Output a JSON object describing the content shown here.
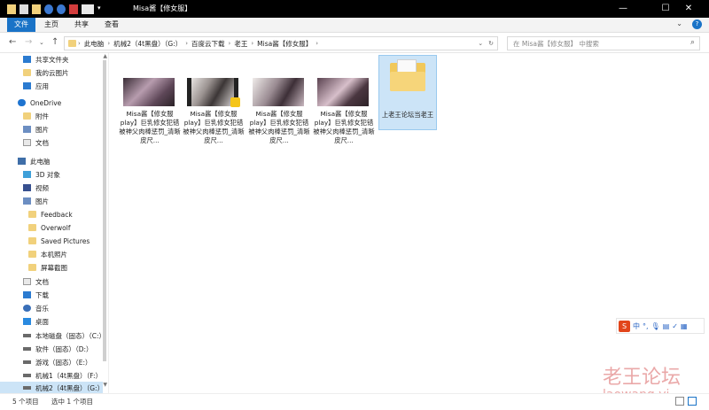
{
  "window": {
    "title": "Misa酱【修女服】",
    "controls": {
      "minimize": "—",
      "maximize": "☐",
      "close": "✕"
    }
  },
  "ribbon": {
    "tabs": [
      {
        "label": "文件",
        "active": true
      },
      {
        "label": "主页",
        "active": false
      },
      {
        "label": "共享",
        "active": false
      },
      {
        "label": "查看",
        "active": false
      }
    ],
    "help": "?"
  },
  "address": {
    "crumbs": [
      "此电脑",
      "机械2（4t黑盘）（G:）",
      "百度云下载",
      "老王",
      "Misa酱【修女服】"
    ],
    "search_placeholder": "在 Misa酱【修女服】 中搜索"
  },
  "sidebar": {
    "items": [
      {
        "label": "共享文件夹",
        "icon": "shared-folder-icon"
      },
      {
        "label": "我的云图片",
        "icon": "folder-icon"
      },
      {
        "label": "应用",
        "icon": "apps-icon"
      },
      {
        "label": "OneDrive",
        "icon": "onedrive-cloud-icon"
      },
      {
        "label": "附件",
        "icon": "folder-icon"
      },
      {
        "label": "图片",
        "icon": "pictures-icon"
      },
      {
        "label": "文档",
        "icon": "documents-icon"
      },
      {
        "label": "此电脑",
        "icon": "this-pc-icon"
      },
      {
        "label": "3D 对象",
        "icon": "3d-objects-icon"
      },
      {
        "label": "视频",
        "icon": "videos-icon"
      },
      {
        "label": "图片",
        "icon": "pictures-icon"
      },
      {
        "label": "Feedback",
        "icon": "folder-icon"
      },
      {
        "label": "Overwolf",
        "icon": "folder-icon"
      },
      {
        "label": "Saved Pictures",
        "icon": "folder-icon"
      },
      {
        "label": "本机照片",
        "icon": "folder-icon"
      },
      {
        "label": "屏幕截图",
        "icon": "folder-icon"
      },
      {
        "label": "文档",
        "icon": "documents-icon"
      },
      {
        "label": "下载",
        "icon": "downloads-icon"
      },
      {
        "label": "音乐",
        "icon": "music-icon"
      },
      {
        "label": "桌面",
        "icon": "desktop-icon"
      },
      {
        "label": "本地磁盘（固态）（C:）",
        "icon": "drive-icon"
      },
      {
        "label": "软件（固态）（D:）",
        "icon": "drive-icon"
      },
      {
        "label": "游戏（固态）（E:）",
        "icon": "drive-icon"
      },
      {
        "label": "机械1（4t黑盘）（F:）",
        "icon": "drive-icon"
      },
      {
        "label": "机械2（4t黑盘）（G:）",
        "icon": "drive-icon",
        "selected": true
      }
    ]
  },
  "files": [
    {
      "name": "Misa酱【修女服play】巨乳修女犯错被神父肉棒惩罚_清晰皮尺...",
      "kind": "image"
    },
    {
      "name": "Misa酱【修女服play】巨乳修女犯错被神父肉棒惩罚_清晰皮尺...",
      "kind": "video"
    },
    {
      "name": "Misa酱【修女服play】巨乳修女犯错被神父肉棒惩罚_清晰皮尺...",
      "kind": "image"
    },
    {
      "name": "Misa酱【修女服play】巨乳修女犯错被神父肉棒惩罚_清晰皮尺...",
      "kind": "image"
    },
    {
      "name": "上老王论坛当老王",
      "kind": "folder",
      "selected": true
    }
  ],
  "status": {
    "count": "5 个项目",
    "selected": "选中 1 个项目"
  },
  "ime": {
    "logo": "S",
    "items": [
      "中",
      "°,",
      "🎙",
      "▤",
      "✓",
      "▦"
    ]
  },
  "watermark": {
    "text": "老王论坛",
    "url": "laowang.vi"
  },
  "colors": {
    "accent": "#1a73c7",
    "selection": "#cce4f7",
    "folder": "#f1d17c"
  }
}
